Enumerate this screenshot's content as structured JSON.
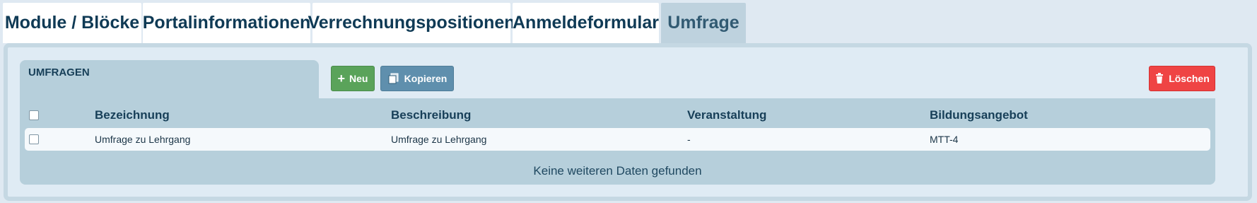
{
  "tabs": [
    {
      "label": "Module / Blöcke"
    },
    {
      "label": "Portalinformationen"
    },
    {
      "label": "Verrechnungspositionen"
    },
    {
      "label": "Anmeldeformular"
    },
    {
      "label": "Umfrage"
    }
  ],
  "active_tab": "Umfrage",
  "panel": {
    "title": "UMFRAGEN",
    "buttons": {
      "new_label": "Neu",
      "copy_label": "Kopieren",
      "delete_label": "Löschen"
    }
  },
  "table": {
    "columns": [
      "Bezeichnung",
      "Beschreibung",
      "Veranstaltung",
      "Bildungsangebot"
    ],
    "rows": [
      [
        "Umfrage zu Lehrgang",
        "Umfrage zu Lehrgang",
        "-",
        "MTT-4"
      ]
    ],
    "empty_message": "Keine weiteren Daten gefunden"
  },
  "colors": {
    "accent": "#0f3a55",
    "new_button": "#5aa35a",
    "copy_button": "#5f8fad",
    "delete_button": "#ef4444",
    "panel_bg": "#b6cfdb"
  },
  "icons": {
    "new": "plus-icon",
    "copy": "copy-icon",
    "delete": "trash-icon"
  }
}
